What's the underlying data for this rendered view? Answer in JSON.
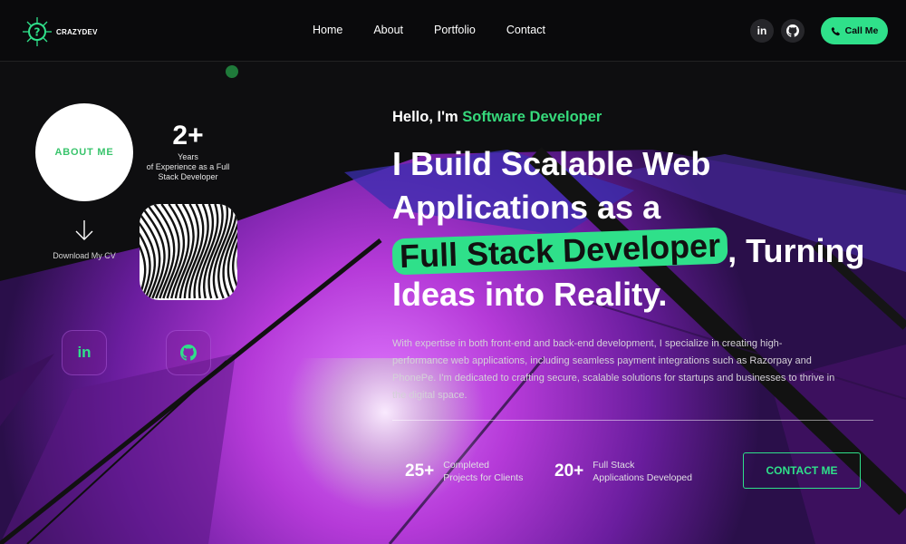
{
  "brand": {
    "name": "CRAZYDEV",
    "logo_icon": "circuit-question-icon"
  },
  "nav": {
    "items": [
      "Home",
      "About",
      "Portfolio",
      "Contact"
    ]
  },
  "header_social": {
    "linkedin_label": "in",
    "github_icon": "github-icon"
  },
  "call_button": {
    "label": "Call Me",
    "icon": "phone-icon"
  },
  "left_panel": {
    "about_label": "ABOUT ME",
    "years_value": "2+",
    "years_label": "Years",
    "years_desc": "of Experience as a Full Stack Developer",
    "download_label": "Download My CV",
    "linkedin_label": "in"
  },
  "hero": {
    "greeting": "Hello, I'm ",
    "role": "Software Developer",
    "headline_line1": "I Build Scalable Web",
    "headline_line2": "Applications as a",
    "headline_highlight": "Full Stack Developer",
    "headline_after": ", Turning",
    "headline_line4": "Ideas into Reality.",
    "description": "With expertise in both front-end and back-end development, I specialize in creating high-performance web applications, including seamless payment integrations such as Razorpay and PhonePe. I'm dedicated to crafting secure, scalable solutions for startups and businesses to thrive in the digital space."
  },
  "stats": [
    {
      "value": "25+",
      "label_line1": "Completed",
      "label_line2": "Projects for Clients"
    },
    {
      "value": "20+",
      "label_line1": "Full Stack",
      "label_line2": "Applications Developed"
    }
  ],
  "contact_button": {
    "label": "CONTACT ME"
  },
  "colors": {
    "accent": "#2fe08a",
    "accent_text": "#36d97b",
    "background": "#0d0d0f",
    "purple": "#8e2bc6"
  }
}
